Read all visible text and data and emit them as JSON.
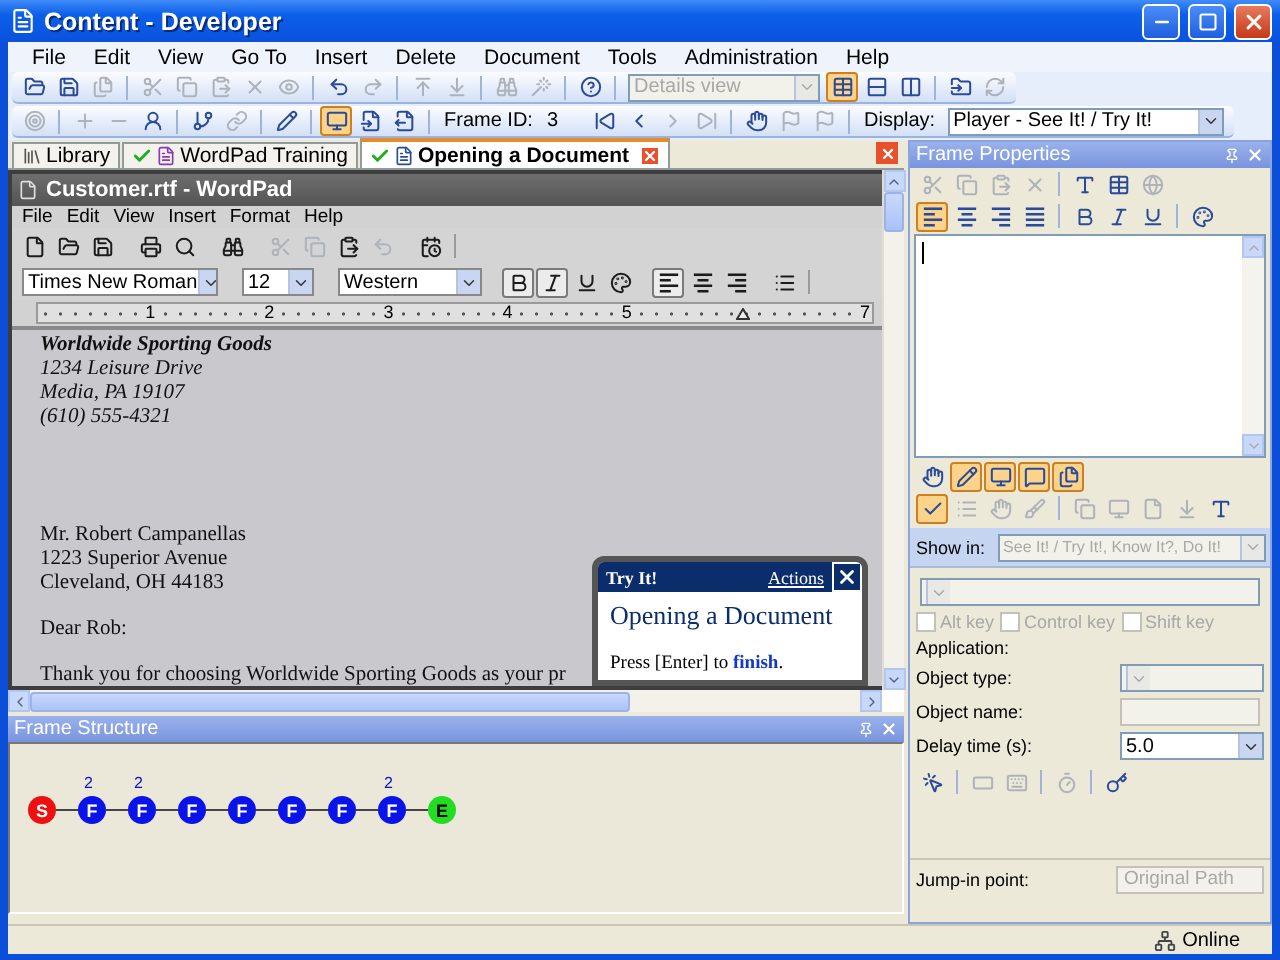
{
  "window": {
    "title": "Content - Developer"
  },
  "menu": [
    "File",
    "Edit",
    "View",
    "Go To",
    "Insert",
    "Delete",
    "Document",
    "Tools",
    "Administration",
    "Help"
  ],
  "toolbar_1": [
    {
      "kind": "button",
      "disabled": false,
      "selected": false
    },
    {
      "kind": "button",
      "disabled": false,
      "selected": false
    },
    {
      "kind": "button",
      "disabled": true,
      "selected": false
    },
    {
      "kind": "sep"
    },
    {
      "kind": "button",
      "disabled": true,
      "selected": false
    },
    {
      "kind": "button",
      "disabled": true,
      "selected": false
    },
    {
      "kind": "button",
      "disabled": true,
      "selected": false
    },
    {
      "kind": "button",
      "disabled": true,
      "selected": false
    },
    {
      "kind": "button",
      "disabled": true,
      "selected": false
    },
    {
      "kind": "sep"
    },
    {
      "kind": "button",
      "disabled": false,
      "selected": false
    },
    {
      "kind": "button",
      "disabled": true,
      "selected": false
    },
    {
      "kind": "sep"
    },
    {
      "kind": "button",
      "disabled": true,
      "selected": false
    },
    {
      "kind": "button",
      "disabled": true,
      "selected": false
    },
    {
      "kind": "sep"
    },
    {
      "kind": "button",
      "disabled": true,
      "selected": false
    },
    {
      "kind": "button",
      "disabled": true,
      "selected": false
    },
    {
      "kind": "sep"
    },
    {
      "kind": "button",
      "disabled": false,
      "selected": false
    },
    {
      "kind": "sep"
    },
    {
      "kind": "select",
      "value": "Details view",
      "disabled": true
    },
    {
      "kind": "button",
      "disabled": false,
      "selected": true
    },
    {
      "kind": "button",
      "disabled": false,
      "selected": false
    },
    {
      "kind": "button",
      "disabled": false,
      "selected": false
    },
    {
      "kind": "sep"
    },
    {
      "kind": "button",
      "disabled": false,
      "selected": false
    },
    {
      "kind": "button",
      "disabled": true,
      "selected": false
    }
  ],
  "toolbar_2": [
    {
      "kind": "button",
      "disabled": true,
      "selected": false
    },
    {
      "kind": "sep"
    },
    {
      "kind": "button",
      "disabled": true,
      "selected": false
    },
    {
      "kind": "button",
      "disabled": true,
      "selected": false
    },
    {
      "kind": "button",
      "disabled": false,
      "selected": false
    },
    {
      "kind": "sep"
    },
    {
      "kind": "button",
      "disabled": false,
      "selected": false
    },
    {
      "kind": "button",
      "disabled": true,
      "selected": false
    },
    {
      "kind": "sep"
    },
    {
      "kind": "button",
      "disabled": false,
      "selected": false
    },
    {
      "kind": "sep"
    },
    {
      "kind": "button",
      "disabled": false,
      "selected": true
    },
    {
      "kind": "button",
      "disabled": false,
      "selected": false
    },
    {
      "kind": "button",
      "disabled": false,
      "selected": false
    },
    {
      "kind": "sep"
    },
    {
      "kind": "label",
      "text": "Frame ID:"
    },
    {
      "kind": "value",
      "text": "3"
    },
    {
      "kind": "button",
      "disabled": false,
      "selected": false
    },
    {
      "kind": "button",
      "disabled": false,
      "selected": false
    },
    {
      "kind": "button",
      "disabled": true,
      "selected": false
    },
    {
      "kind": "button",
      "disabled": true,
      "selected": false
    },
    {
      "kind": "sep"
    },
    {
      "kind": "button",
      "disabled": false,
      "selected": false
    },
    {
      "kind": "button",
      "disabled": true,
      "selected": false
    },
    {
      "kind": "button",
      "disabled": true,
      "selected": false
    },
    {
      "kind": "sep"
    },
    {
      "kind": "label",
      "text": "Display:"
    },
    {
      "kind": "select",
      "value": "Player - See It! / Try It!",
      "disabled": false
    }
  ],
  "tabs": [
    {
      "label": "Library",
      "selected": false,
      "checked": false
    },
    {
      "label": "WordPad Training",
      "selected": false,
      "checked": true
    },
    {
      "label": "Opening a Document",
      "selected": true,
      "checked": true
    }
  ],
  "wordpad": {
    "title": "Customer.rtf - WordPad",
    "menu": [
      "File",
      "Edit",
      "View",
      "Insert",
      "Format",
      "Help"
    ],
    "toolbar": [
      {
        "kind": "button",
        "disabled": false,
        "selected": false
      },
      {
        "kind": "button",
        "disabled": false,
        "selected": false
      },
      {
        "kind": "button",
        "disabled": false,
        "selected": false
      },
      {
        "kind": "gap"
      },
      {
        "kind": "button",
        "disabled": false,
        "selected": false
      },
      {
        "kind": "button",
        "disabled": false,
        "selected": false
      },
      {
        "kind": "gap"
      },
      {
        "kind": "button",
        "disabled": false,
        "selected": false
      },
      {
        "kind": "gap"
      },
      {
        "kind": "button",
        "disabled": true,
        "selected": false
      },
      {
        "kind": "button",
        "disabled": true,
        "selected": false
      },
      {
        "kind": "button",
        "disabled": false,
        "selected": false
      },
      {
        "kind": "button",
        "disabled": true,
        "selected": false
      },
      {
        "kind": "gap"
      },
      {
        "kind": "button",
        "disabled": false,
        "selected": false
      },
      {
        "kind": "sep"
      }
    ],
    "format_bar": [
      {
        "kind": "select",
        "value": "Times New Roman",
        "disabled": false
      },
      {
        "kind": "gap"
      },
      {
        "kind": "select",
        "value": "12",
        "disabled": false
      },
      {
        "kind": "gap"
      },
      {
        "kind": "select",
        "value": "Western",
        "disabled": false
      },
      {
        "kind": "gap"
      },
      {
        "kind": "button",
        "disabled": false,
        "selected": true
      },
      {
        "kind": "button",
        "disabled": false,
        "selected": true
      },
      {
        "kind": "button",
        "disabled": false,
        "selected": false
      },
      {
        "kind": "button",
        "disabled": false,
        "selected": false
      },
      {
        "kind": "gap"
      },
      {
        "kind": "button",
        "disabled": false,
        "selected": true
      },
      {
        "kind": "button",
        "disabled": false,
        "selected": false
      },
      {
        "kind": "button",
        "disabled": false,
        "selected": false
      },
      {
        "kind": "gap"
      },
      {
        "kind": "button",
        "disabled": false,
        "selected": false
      },
      {
        "kind": "sep"
      }
    ],
    "ruler": [
      {
        "kind": "number",
        "label": "1"
      },
      {
        "kind": "number",
        "label": "2"
      },
      {
        "kind": "number",
        "label": "3"
      },
      {
        "kind": "number",
        "label": "4"
      },
      {
        "kind": "number",
        "label": "5"
      },
      {
        "kind": "indent"
      },
      {
        "kind": "number",
        "label": "7"
      }
    ],
    "document": {
      "letterhead": {
        "company": "Worldwide Sporting Goods",
        "lines": [
          "1234 Leisure Drive",
          "Media, PA 19107",
          "(610) 555-4321"
        ]
      },
      "recipient": [
        "Mr. Robert Campanellas",
        "1223 Superior Avenue",
        "Cleveland, OH  44183"
      ],
      "salutation": "Dear Rob:",
      "body": "Thank you for choosing Worldwide Sporting Goods as your pr"
    }
  },
  "try_it": {
    "header": "Try It!",
    "actions": "Actions",
    "title": "Opening a Document",
    "instruction": "Press [Enter] to **finish**."
  },
  "frame_structure": {
    "title": "Frame Structure",
    "nodes": [
      {
        "kind": "start",
        "label": "S"
      },
      {
        "kind": "frame",
        "label": "F",
        "badge": "2"
      },
      {
        "kind": "frame",
        "label": "F",
        "badge": "2"
      },
      {
        "kind": "frame",
        "label": "F"
      },
      {
        "kind": "frame",
        "label": "F"
      },
      {
        "kind": "frame",
        "label": "F"
      },
      {
        "kind": "frame",
        "label": "F"
      },
      {
        "kind": "frame",
        "label": "F",
        "badge": "2"
      },
      {
        "kind": "end",
        "label": "E"
      }
    ]
  },
  "frame_properties": {
    "title": "Frame Properties",
    "toolbar_1": [
      {
        "kind": "button",
        "disabled": true,
        "selected": false
      },
      {
        "kind": "button",
        "disabled": true,
        "selected": false
      },
      {
        "kind": "button",
        "disabled": true,
        "selected": false
      },
      {
        "kind": "button",
        "disabled": true,
        "selected": false
      },
      {
        "kind": "sep"
      },
      {
        "kind": "button",
        "disabled": false,
        "selected": false
      },
      {
        "kind": "button",
        "disabled": false,
        "selected": false
      },
      {
        "kind": "button",
        "disabled": true,
        "selected": false
      }
    ],
    "toolbar_2": [
      {
        "kind": "button",
        "disabled": false,
        "selected": true
      },
      {
        "kind": "button",
        "disabled": false,
        "selected": false
      },
      {
        "kind": "button",
        "disabled": false,
        "selected": false
      },
      {
        "kind": "button",
        "disabled": false,
        "selected": false
      },
      {
        "kind": "sep"
      },
      {
        "kind": "button",
        "disabled": false,
        "selected": false
      },
      {
        "kind": "button",
        "disabled": false,
        "selected": false
      },
      {
        "kind": "button",
        "disabled": false,
        "selected": false
      },
      {
        "kind": "sep"
      },
      {
        "kind": "button",
        "disabled": false,
        "selected": false
      }
    ],
    "view_tabs": [
      {
        "kind": "button",
        "disabled": false,
        "selected": false
      },
      {
        "kind": "button",
        "disabled": false,
        "selected": true
      },
      {
        "kind": "button",
        "disabled": false,
        "selected": true
      },
      {
        "kind": "button",
        "disabled": false,
        "selected": true
      },
      {
        "kind": "button",
        "disabled": false,
        "selected": true
      }
    ],
    "toolbar_3": [
      {
        "kind": "button",
        "disabled": false,
        "selected": true
      },
      {
        "kind": "button",
        "disabled": true,
        "selected": false
      },
      {
        "kind": "button",
        "disabled": true,
        "selected": false
      },
      {
        "kind": "button",
        "disabled": true,
        "selected": false
      },
      {
        "kind": "sep"
      },
      {
        "kind": "button",
        "disabled": true,
        "selected": false
      },
      {
        "kind": "button",
        "disabled": true,
        "selected": false
      },
      {
        "kind": "button",
        "disabled": true,
        "selected": false
      },
      {
        "kind": "button",
        "disabled": true,
        "selected": false
      },
      {
        "kind": "button",
        "disabled": false,
        "selected": false
      }
    ],
    "show_in": {
      "label": "Show in:",
      "value": "See It! / Try It!, Know It?, Do It!",
      "disabled": true
    },
    "key_select": {
      "disabled": true
    },
    "checkboxes": [
      {
        "label": "Alt key",
        "checked": false,
        "disabled": true
      },
      {
        "label": "Control key",
        "checked": false,
        "disabled": true
      },
      {
        "label": "Shift key",
        "checked": false,
        "disabled": true
      }
    ],
    "application_label": "Application:",
    "fields": [
      {
        "kind": "select",
        "label": "Object type:",
        "disabled": true
      },
      {
        "kind": "input",
        "label": "Object name:",
        "disabled": true
      },
      {
        "kind": "select",
        "label": "Delay time (s):",
        "value": "5.0",
        "disabled": false
      }
    ],
    "toolbar_4": [
      {
        "kind": "button",
        "disabled": false,
        "selected": false
      },
      {
        "kind": "sep"
      },
      {
        "kind": "button",
        "disabled": true,
        "selected": false
      },
      {
        "kind": "button",
        "disabled": true,
        "selected": false
      },
      {
        "kind": "sep"
      },
      {
        "kind": "button",
        "disabled": true,
        "selected": false
      },
      {
        "kind": "sep"
      },
      {
        "kind": "button",
        "disabled": false,
        "selected": false
      }
    ],
    "jump_in": {
      "label": "Jump-in point:",
      "value": "Original Path",
      "disabled": true
    }
  },
  "status_bar": {
    "text": "Online"
  }
}
